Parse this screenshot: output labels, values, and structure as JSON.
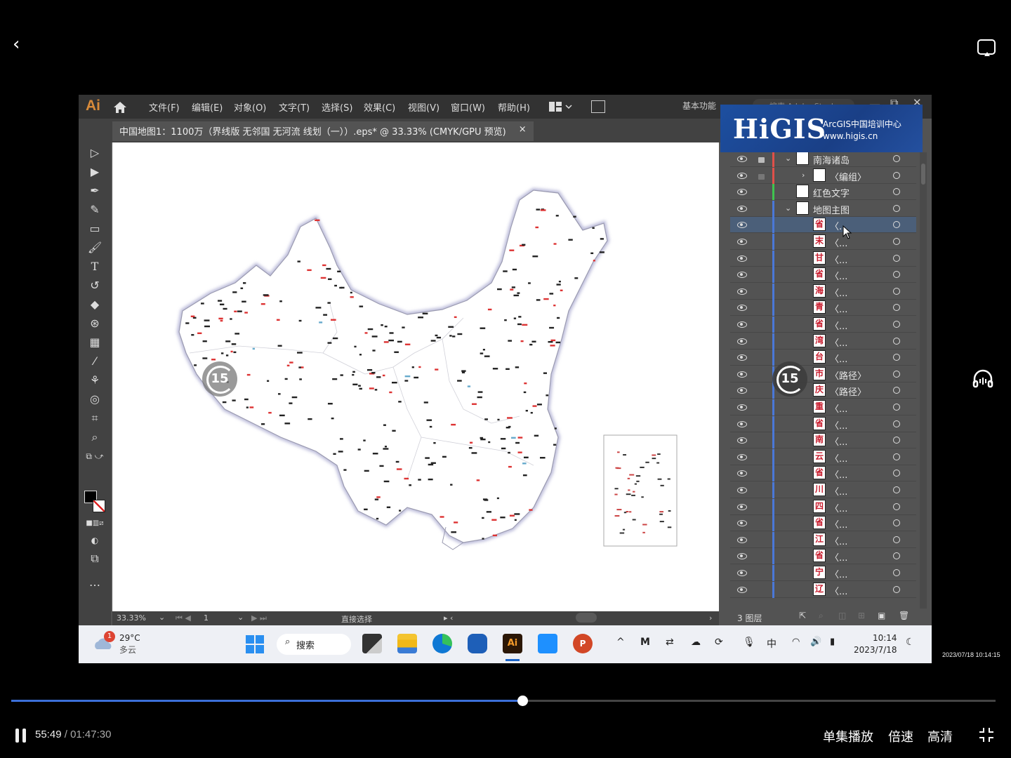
{
  "player": {
    "back_icon": "‹",
    "current_time": "55:49",
    "separator": " / ",
    "duration": "01:47:30",
    "progress": 0.5195,
    "controls": [
      "单集播放",
      "倍速",
      "高清"
    ],
    "watermark_timestamp": "2023/07/18 10:14:15",
    "replay_label": "15"
  },
  "app": {
    "logo": "Ai",
    "menus": [
      "文件(F)",
      "编辑(E)",
      "对象(O)",
      "文字(T)",
      "选择(S)",
      "效果(C)",
      "视图(V)",
      "窗口(W)",
      "帮助(H)"
    ],
    "workspace": "基本功能",
    "search_placeholder": "搜索 Adobe Stock",
    "document_tab": "中国地图1：1100万（界线版 无邻国 无河流 线划（一））.eps* @ 33.33% (CMYK/GPU 预览)",
    "close_tab": "×",
    "status": {
      "zoom": "33.33%",
      "artboard": "1",
      "tool": "直接选择"
    }
  },
  "banner": {
    "logo": "HiGIS",
    "line1": "ArcGIS中国培训中心",
    "line2": "www.higis.cn"
  },
  "layers": {
    "count_label": "3 图层",
    "rows": [
      {
        "name": "南海诸岛",
        "color": "#e0504a",
        "locked": true,
        "expanded": true,
        "level": 0,
        "thumb": ""
      },
      {
        "name": "〈编组〉",
        "color": "#e0504a",
        "locked": true,
        "expanded": false,
        "level": 1,
        "thumb": ""
      },
      {
        "name": "红色文字",
        "color": "#3fc44f",
        "locked": false,
        "level": 0,
        "thumb": ""
      },
      {
        "name": "地图主图",
        "color": "#4a78d8",
        "locked": false,
        "expanded": true,
        "level": 0,
        "thumb": ""
      },
      {
        "name": "〈...",
        "color": "#4a78d8",
        "level": 2,
        "thumb": "省",
        "selected": true
      },
      {
        "name": "〈...",
        "color": "#4a78d8",
        "level": 2,
        "thumb": "末"
      },
      {
        "name": "〈...",
        "color": "#4a78d8",
        "level": 2,
        "thumb": "甘"
      },
      {
        "name": "〈...",
        "color": "#4a78d8",
        "level": 2,
        "thumb": "省"
      },
      {
        "name": "〈...",
        "color": "#4a78d8",
        "level": 2,
        "thumb": "海"
      },
      {
        "name": "〈...",
        "color": "#4a78d8",
        "level": 2,
        "thumb": "青"
      },
      {
        "name": "〈...",
        "color": "#4a78d8",
        "level": 2,
        "thumb": "省"
      },
      {
        "name": "〈...",
        "color": "#4a78d8",
        "level": 2,
        "thumb": "湾"
      },
      {
        "name": "〈...",
        "color": "#4a78d8",
        "level": 2,
        "thumb": "台"
      },
      {
        "name": "〈路径〉",
        "color": "#4a78d8",
        "level": 2,
        "thumb": "市"
      },
      {
        "name": "〈路径〉",
        "color": "#4a78d8",
        "level": 2,
        "thumb": "庆"
      },
      {
        "name": "〈...",
        "color": "#4a78d8",
        "level": 2,
        "thumb": "重"
      },
      {
        "name": "〈...",
        "color": "#4a78d8",
        "level": 2,
        "thumb": "省"
      },
      {
        "name": "〈...",
        "color": "#4a78d8",
        "level": 2,
        "thumb": "南"
      },
      {
        "name": "〈...",
        "color": "#4a78d8",
        "level": 2,
        "thumb": "云"
      },
      {
        "name": "〈...",
        "color": "#4a78d8",
        "level": 2,
        "thumb": "省"
      },
      {
        "name": "〈...",
        "color": "#4a78d8",
        "level": 2,
        "thumb": "川"
      },
      {
        "name": "〈...",
        "color": "#4a78d8",
        "level": 2,
        "thumb": "四"
      },
      {
        "name": "〈...",
        "color": "#4a78d8",
        "level": 2,
        "thumb": "省"
      },
      {
        "name": "〈...",
        "color": "#4a78d8",
        "level": 2,
        "thumb": "江"
      },
      {
        "name": "〈...",
        "color": "#4a78d8",
        "level": 2,
        "thumb": "省"
      },
      {
        "name": "〈...",
        "color": "#4a78d8",
        "level": 2,
        "thumb": "宁"
      },
      {
        "name": "〈...",
        "color": "#4a78d8",
        "level": 2,
        "thumb": "辽"
      }
    ]
  },
  "taskbar": {
    "weather_temp": "29°C",
    "weather_desc": "多云",
    "weather_badge": "1",
    "search_label": "搜索",
    "ime": "中",
    "clock_time": "10:14",
    "clock_date": "2023/7/18"
  },
  "colors": {
    "accent": "#3b6fd8",
    "ai_orange": "#d98b3a",
    "banner_blue": "#1d4fa0",
    "selected_row": "#4b5f79"
  }
}
